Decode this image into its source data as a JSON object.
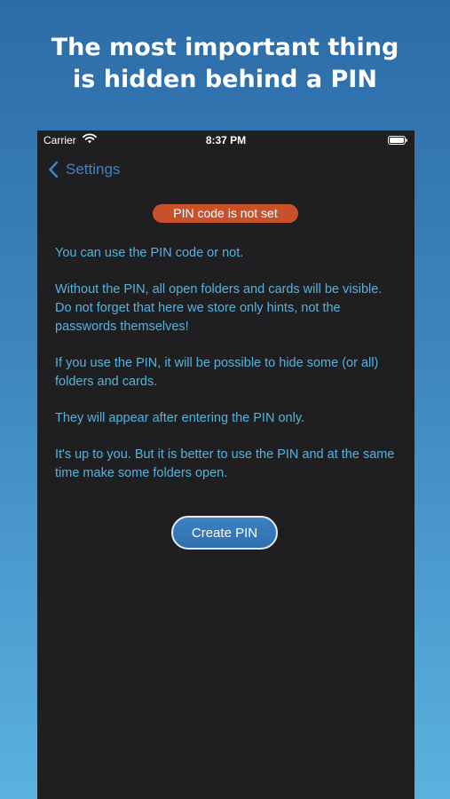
{
  "promo": {
    "headline_line1": "The most important thing",
    "headline_line2": "is hidden behind a PIN"
  },
  "status_bar": {
    "carrier": "Carrier",
    "time": "8:37 PM",
    "icons": [
      "wifi-icon",
      "battery-icon"
    ]
  },
  "nav": {
    "back_label": "Settings",
    "back_icon": "chevron-left-icon"
  },
  "status_badge": {
    "text": "PIN code is not set",
    "color": "#c7522a"
  },
  "body": {
    "paragraphs": [
      "You can use the PIN code or not.",
      "Without the PIN, all open folders and cards will be visible. Do not forget that here we store only hints, not the passwords themselves!",
      "If you use the PIN, it will be possible to hide some (or all) folders and cards.",
      "They will appear after entering the PIN only.",
      "It's up to you. But it is better to use the PIN and at the same time make some folders open."
    ]
  },
  "actions": {
    "create_pin_label": "Create PIN"
  },
  "colors": {
    "accent": "#3f84c8",
    "body_text": "#54b3de",
    "screen_background": "#1f1f21"
  }
}
